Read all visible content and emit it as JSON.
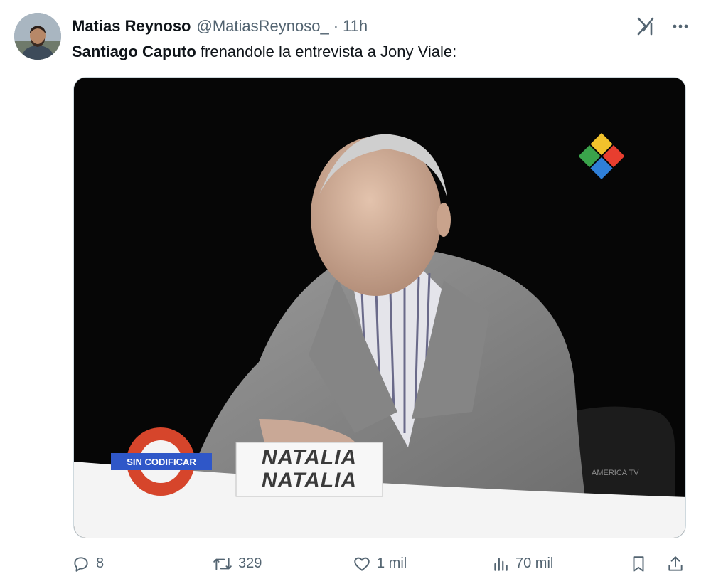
{
  "tweet": {
    "author_name": "Matias Reynoso",
    "author_handle": "@MatiasReynoso_",
    "separator": "·",
    "time": "11h",
    "text_bold": "Santiago Caputo",
    "text_rest": " frenandole la entrevista a Jony Viale:",
    "media": {
      "nameplate_line1": "NATALIA",
      "nameplate_line2": "NATALIA",
      "roundel_banner": "SIN CODIFICAR",
      "chair_text": "AMERICA TV"
    }
  },
  "actions": {
    "replies": "8",
    "reposts": "329",
    "likes": "1 mil",
    "views": "70 mil"
  },
  "icons": [
    "grok-icon",
    "more-icon",
    "reply-icon",
    "repost-icon",
    "like-icon",
    "views-icon",
    "bookmark-icon",
    "share-icon"
  ],
  "colors": {
    "text_primary": "#0f1419",
    "text_secondary": "#536471",
    "roundel_red": "#d6452b",
    "roundel_blue": "#2f57c8"
  }
}
